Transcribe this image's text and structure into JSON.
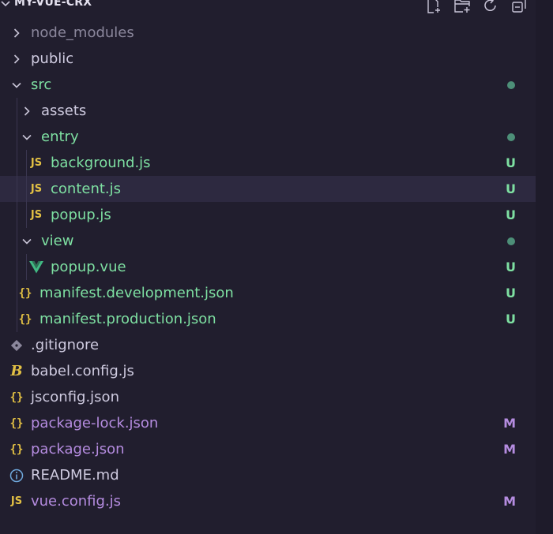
{
  "explorer": {
    "title": "MY-VUE-CRX",
    "actions": [
      "new-file-icon",
      "new-folder-icon",
      "refresh-icon",
      "collapse-all-icon"
    ]
  },
  "colors": {
    "background": "#211e2e",
    "untracked": "#7ee0a2",
    "modified": "#b58ce0",
    "normal": "#cfcbe0",
    "ignored": "#8b879c",
    "js_icon": "#e2c044",
    "json_icon": "#e2c044",
    "vue_icon": "#41b883",
    "info_icon": "#6fa8dc",
    "git_icon": "#8b879c"
  },
  "tree": [
    {
      "label": "node_modules",
      "type": "folder",
      "open": false,
      "depth": 0,
      "status": "ignored",
      "badge": ""
    },
    {
      "label": "public",
      "type": "folder",
      "open": false,
      "depth": 0,
      "status": "normal",
      "badge": ""
    },
    {
      "label": "src",
      "type": "folder",
      "open": true,
      "depth": 0,
      "status": "untracked",
      "badge": "dot"
    },
    {
      "label": "assets",
      "type": "folder",
      "open": false,
      "depth": 1,
      "status": "normal",
      "badge": ""
    },
    {
      "label": "entry",
      "type": "folder",
      "open": true,
      "depth": 1,
      "status": "untracked",
      "badge": "dot"
    },
    {
      "label": "background.js",
      "type": "js",
      "depth": 2,
      "status": "untracked",
      "badge": "U"
    },
    {
      "label": "content.js",
      "type": "js",
      "depth": 2,
      "status": "untracked",
      "badge": "U",
      "selected": true
    },
    {
      "label": "popup.js",
      "type": "js",
      "depth": 2,
      "status": "untracked",
      "badge": "U"
    },
    {
      "label": "view",
      "type": "folder",
      "open": true,
      "depth": 1,
      "status": "untracked",
      "badge": "dot"
    },
    {
      "label": "popup.vue",
      "type": "vue",
      "depth": 2,
      "status": "untracked",
      "badge": "U"
    },
    {
      "label": "manifest.development.json",
      "type": "json",
      "depth": 1,
      "status": "untracked",
      "badge": "U"
    },
    {
      "label": "manifest.production.json",
      "type": "json",
      "depth": 1,
      "status": "untracked",
      "badge": "U"
    },
    {
      "label": ".gitignore",
      "type": "git",
      "depth": 0,
      "status": "normal",
      "badge": ""
    },
    {
      "label": "babel.config.js",
      "type": "babel",
      "depth": 0,
      "status": "normal",
      "badge": ""
    },
    {
      "label": "jsconfig.json",
      "type": "json",
      "depth": 0,
      "status": "normal",
      "badge": ""
    },
    {
      "label": "package-lock.json",
      "type": "json",
      "depth": 0,
      "status": "modified",
      "badge": "M"
    },
    {
      "label": "package.json",
      "type": "json",
      "depth": 0,
      "status": "modified",
      "badge": "M"
    },
    {
      "label": "README.md",
      "type": "info",
      "depth": 0,
      "status": "normal",
      "badge": ""
    },
    {
      "label": "vue.config.js",
      "type": "js",
      "depth": 0,
      "status": "modified",
      "badge": "M"
    }
  ]
}
